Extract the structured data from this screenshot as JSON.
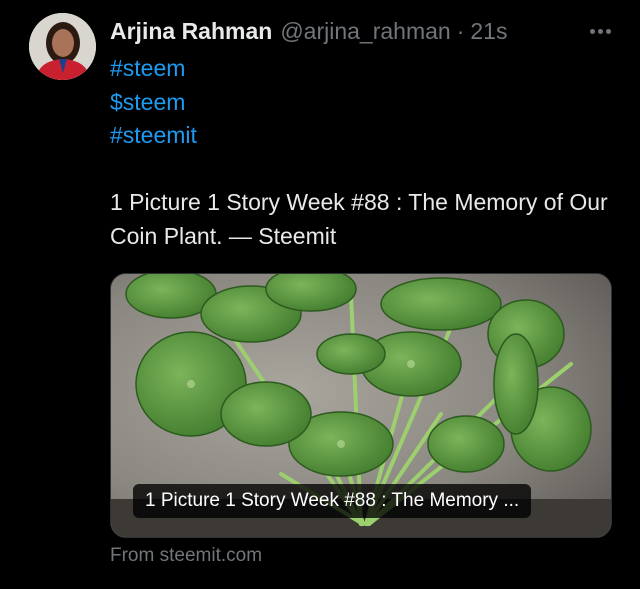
{
  "post": {
    "author_name": "Arjina Rahman",
    "author_handle": "@arjina_rahman",
    "separator": "·",
    "timestamp": "21s",
    "tags": [
      "#steem",
      "$steem",
      "#steemit"
    ],
    "text": "1 Picture 1 Story Week #88 : The Memory of Our Coin Plant. — Steemit",
    "avatar_icon": "user-avatar-photo",
    "more_icon": "more-options-icon"
  },
  "card": {
    "title": "1 Picture 1 Story Week #88 : The Memory ...",
    "source": "From steemit.com",
    "image_subject": "coin-plant-photo"
  },
  "colors": {
    "background": "#000000",
    "text": "#e7e9ea",
    "muted": "#71767b",
    "link": "#1d9bf0",
    "leaf": "#4f8a34"
  }
}
